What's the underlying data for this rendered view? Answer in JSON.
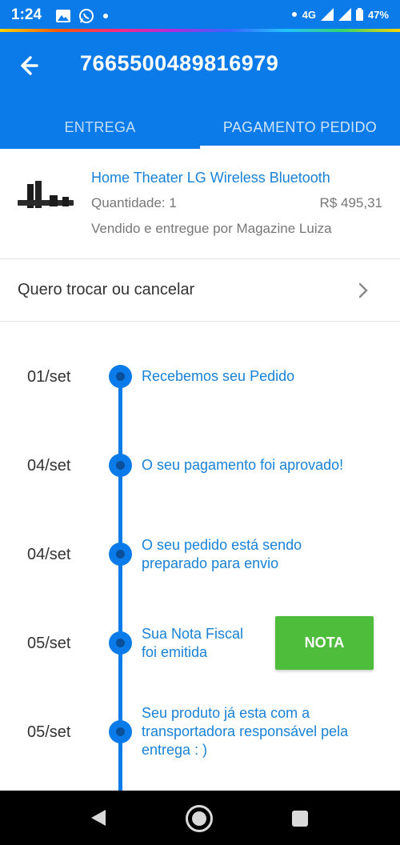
{
  "status_bar": {
    "time": "1:24",
    "network": "4G",
    "battery": "47%",
    "icons": [
      "image-icon",
      "whatsapp-icon",
      "notification-dot-icon",
      "wifi-icon",
      "signal-icon",
      "battery-icon"
    ]
  },
  "header": {
    "title": "7665500489816979",
    "tabs": [
      {
        "label": "ENTREGA"
      },
      {
        "label": "PAGAMENTO PEDIDO"
      }
    ],
    "selected_tab_index": 1
  },
  "product": {
    "name": "Home Theater LG Wireless Bluetooth",
    "quantity": "Quantidade: 1",
    "price": "R$ 495,31",
    "seller": "Vendido e entregue por Magazine Luiza"
  },
  "exchange": {
    "label": "Quero trocar ou cancelar"
  },
  "timeline": [
    {
      "date": "01/set",
      "text": "Recebemos seu Pedido"
    },
    {
      "date": "04/set",
      "text": "O seu pagamento foi aprovado!"
    },
    {
      "date": "04/set",
      "text": "O seu pedido está sendo preparado para envio"
    },
    {
      "date": "05/set",
      "text": "Sua Nota Fiscal foi emitida"
    },
    {
      "date": "05/set",
      "text": "Seu produto já esta com a transportadora responsável pela entrega : )"
    }
  ],
  "nota_button": {
    "label": "NOTA"
  },
  "colors": {
    "primary": "#0a7be8",
    "link": "#1a82d6",
    "success": "#4ebd3c"
  }
}
